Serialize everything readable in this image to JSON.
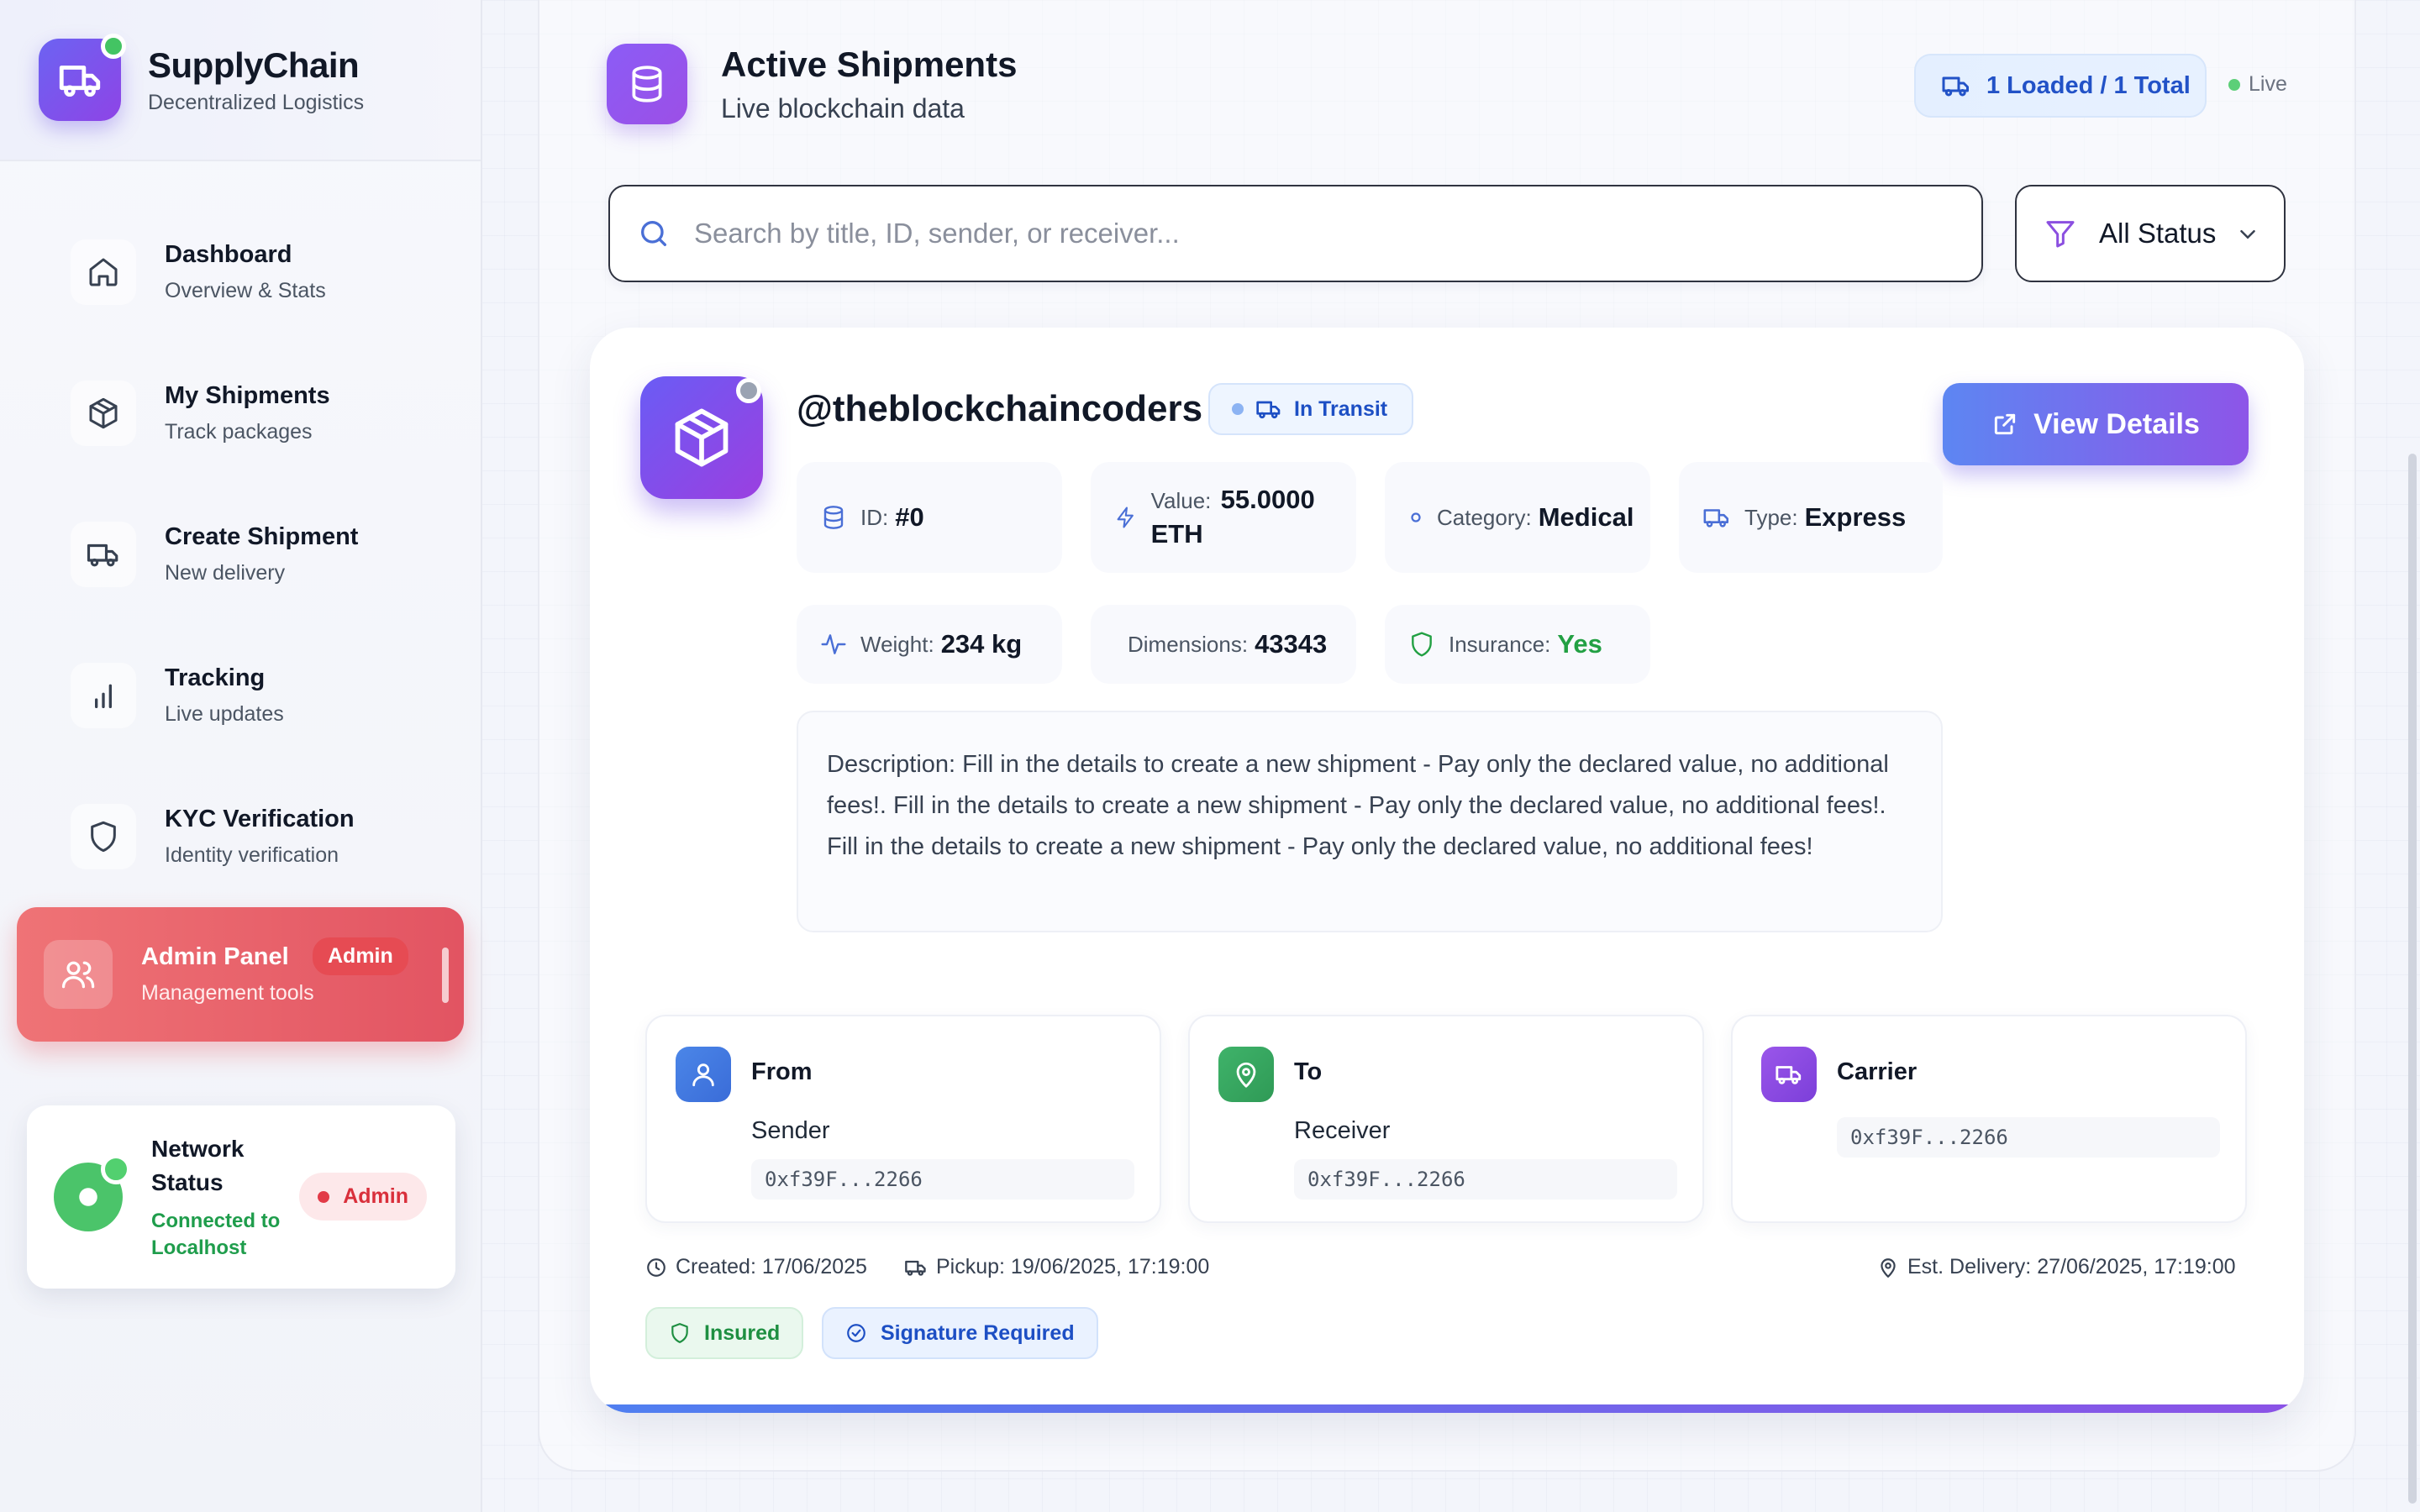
{
  "brand": {
    "title": "SupplyChain",
    "subtitle": "Decentralized Logistics"
  },
  "nav": [
    {
      "title": "Dashboard",
      "sub": "Overview & Stats",
      "icon": "home-icon"
    },
    {
      "title": "My Shipments",
      "sub": "Track packages",
      "icon": "package-icon"
    },
    {
      "title": "Create Shipment",
      "sub": "New delivery",
      "icon": "truck-icon"
    },
    {
      "title": "Tracking",
      "sub": "Live updates",
      "icon": "bar-chart-icon"
    },
    {
      "title": "KYC Verification",
      "sub": "Identity verification",
      "icon": "shield-icon"
    },
    {
      "title": "Admin Panel",
      "sub": "Management tools",
      "badge": "Admin",
      "icon": "users-icon",
      "active": true
    }
  ],
  "network": {
    "title": "Network Status",
    "status": "Connected to Localhost",
    "badge": "Admin"
  },
  "header": {
    "title": "Active Shipments",
    "subtitle": "Live blockchain data",
    "loaded": "1 Loaded / 1 Total",
    "live": "Live"
  },
  "search": {
    "placeholder": "Search by title, ID, sender, or receiver...",
    "value": ""
  },
  "filter": {
    "selected": "All Status"
  },
  "shipment": {
    "title": "@theblockchaincoders",
    "status": "In Transit",
    "view_label": "View Details",
    "id_label": "ID:",
    "id": "#0",
    "value_label": "Value:",
    "value": "55.0000 ETH",
    "category_label": "Category:",
    "category": "Medical",
    "type_label": "Type:",
    "type": "Express",
    "weight_label": "Weight:",
    "weight": "234 kg",
    "dimensions_label": "Dimensions:",
    "dimensions": "43343",
    "insurance_label": "Insurance:",
    "insurance": "Yes",
    "description": "Description: Fill in the details to create a new shipment - Pay only the declared value, no additional fees!. Fill in the details to create a new shipment - Pay only the declared value, no additional fees!. Fill in the details to create a new shipment - Pay only the declared value, no additional fees!",
    "from": {
      "title": "From",
      "name": "Sender",
      "address": "0xf39F...2266"
    },
    "to": {
      "title": "To",
      "name": "Receiver",
      "address": "0xf39F...2266"
    },
    "carrier": {
      "title": "Carrier",
      "address": "0xf39F...2266"
    },
    "created": "Created: 17/06/2025",
    "pickup": "Pickup: 19/06/2025, 17:19:00",
    "delivery": "Est. Delivery: 27/06/2025, 17:19:00",
    "tags": [
      "Insured",
      "Signature Required"
    ]
  },
  "colors": {
    "accent_purple": "#8b5cf6",
    "accent_blue": "#5d86f2",
    "active_red": "#e25462",
    "success_green": "#22a043"
  }
}
